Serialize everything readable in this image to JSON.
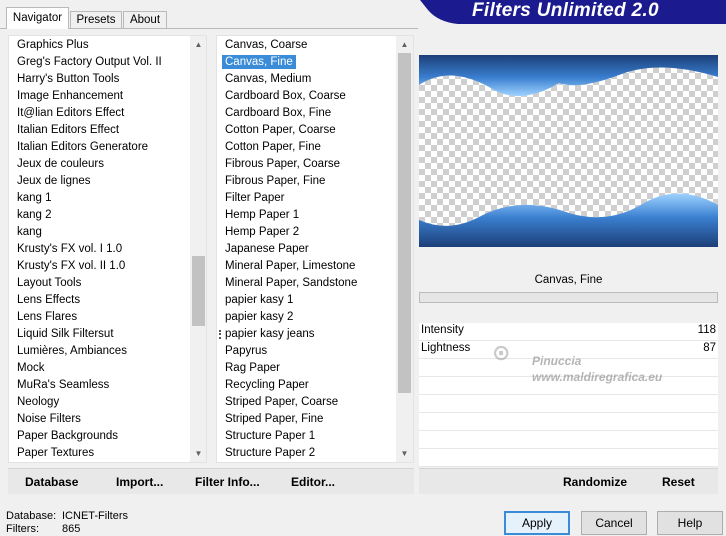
{
  "tabs": [
    {
      "label": "Navigator"
    },
    {
      "label": "Presets"
    },
    {
      "label": "About"
    }
  ],
  "header": {
    "title": "Filters Unlimited 2.0"
  },
  "categories": {
    "items": [
      "Graphics Plus",
      "Greg's Factory Output Vol. II",
      "Harry's Button Tools",
      "Image Enhancement",
      "It@lian Editors Effect",
      "Italian Editors Effect",
      "Italian Editors Generatore",
      "Jeux de couleurs",
      "Jeux de lignes",
      "kang 1",
      "kang 2",
      "kang",
      "Krusty's FX vol. I 1.0",
      "Krusty's FX vol. II 1.0",
      "Layout Tools",
      "Lens Effects",
      "Lens Flares",
      "Liquid Silk Filtersut",
      "Lumières, Ambiances",
      "Mock",
      "MuRa's Seamless",
      "Neology",
      "Noise Filters",
      "Paper Backgrounds",
      "Paper Textures"
    ]
  },
  "filters": {
    "selected": "Canvas, Fine",
    "items": [
      "Canvas, Coarse",
      "Canvas, Fine",
      "Canvas, Medium",
      "Cardboard Box, Coarse",
      "Cardboard Box, Fine",
      "Cotton Paper, Coarse",
      "Cotton Paper, Fine",
      "Fibrous Paper, Coarse",
      "Fibrous Paper, Fine",
      "Filter Paper",
      "Hemp Paper 1",
      "Hemp Paper 2",
      "Japanese Paper",
      "Mineral Paper, Limestone",
      "Mineral Paper, Sandstone",
      "papier kasy 1",
      "papier kasy 2",
      "papier kasy jeans",
      "Papyrus",
      "Rag Paper",
      "Recycling Paper",
      "Striped Paper, Coarse",
      "Striped Paper, Fine",
      "Structure Paper 1",
      "Structure Paper 2"
    ]
  },
  "actions_left": {
    "database": "Database",
    "import": "Import...",
    "filter_info": "Filter Info...",
    "editor": "Editor..."
  },
  "actions_right": {
    "randomize": "Randomize",
    "reset": "Reset"
  },
  "preview": {
    "filter_name": "Canvas, Fine",
    "progress": 0
  },
  "params": [
    {
      "label": "Intensity",
      "value": "118"
    },
    {
      "label": "Lightness",
      "value": "87"
    }
  ],
  "watermark": {
    "line1": "Pinuccia",
    "line2": "www.maldiregrafica.eu"
  },
  "status": {
    "database_label": "Database:",
    "database_value": "ICNET-Filters",
    "filters_label": "Filters:",
    "filters_value": "865"
  },
  "buttons": {
    "apply": "Apply",
    "cancel": "Cancel",
    "help": "Help"
  },
  "colors": {
    "accent": "#3a8bd8",
    "banner": "#1b1b8f",
    "preview_blue": "#3a7fd0"
  }
}
